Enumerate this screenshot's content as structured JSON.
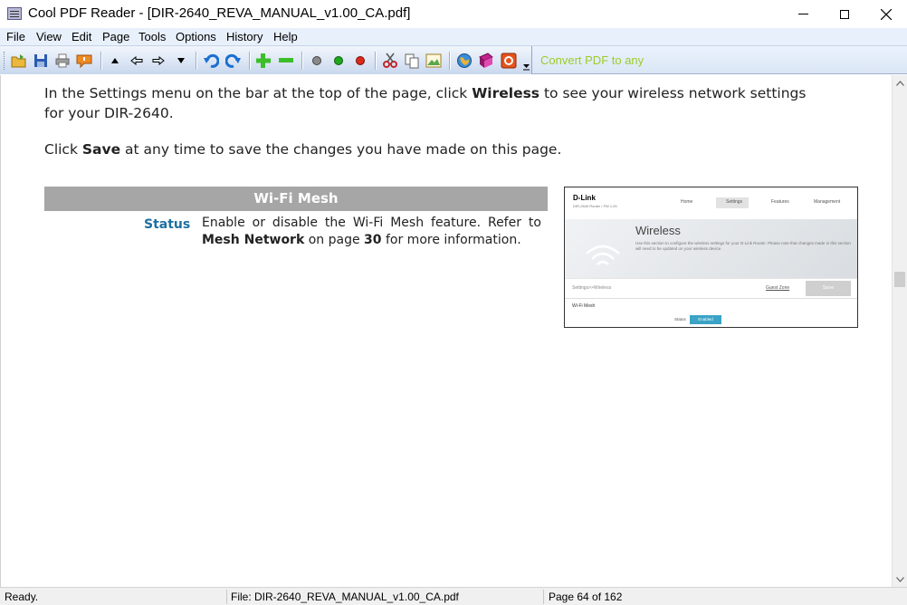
{
  "window": {
    "title": "Cool PDF Reader - [DIR-2640_REVA_MANUAL_v1.00_CA.pdf]"
  },
  "menu": [
    {
      "label": "File"
    },
    {
      "label": "View"
    },
    {
      "label": "Edit"
    },
    {
      "label": "Page"
    },
    {
      "label": "Tools"
    },
    {
      "label": "Options"
    },
    {
      "label": "History"
    },
    {
      "label": "Help"
    }
  ],
  "toolbar": {
    "convert_label": "Convert PDF to any",
    "icons": [
      "open-folder-icon",
      "save-icon",
      "print-icon",
      "comment-icon",
      "page-up-icon",
      "back-icon",
      "forward-icon",
      "page-down-icon",
      "undo-icon",
      "redo-icon",
      "zoom-in-icon",
      "zoom-out-icon",
      "gray-dot-icon",
      "green-dot-icon",
      "red-dot-icon",
      "cut-icon",
      "copy-icon",
      "image-icon",
      "globe-icon",
      "book-icon",
      "pdf-convert-icon"
    ]
  },
  "document": {
    "para1_a": "In the Settings menu on the bar at the top of the page, click ",
    "para1_bold": "Wireless",
    "para1_b": " to see your wireless network settings for your DIR-2640.",
    "para2_a": "Click ",
    "para2_bold": "Save",
    "para2_b": " at any time to save the changes you have made on this page.",
    "section_header": "Wi-Fi Mesh",
    "status_label": "Status",
    "status_desc_a": "Enable or disable the Wi-Fi Mesh feature. Refer to ",
    "status_desc_bold1": "Mesh Network",
    "status_desc_b": " on page ",
    "status_desc_bold2": "30",
    "status_desc_c": " for more information.",
    "screenshot": {
      "logo": "D-Link",
      "subtitle": "DIR-2640 Router / FW 1.00",
      "nav": [
        "Home",
        "Settings",
        "Features",
        "Management"
      ],
      "heading": "Wireless",
      "description": "Use this section to configure the wireless settings for your D-Link Router. Please note that changes made in this section will need to be updated on your wireless device.",
      "breadcrumb": "Settings>>Wireless",
      "guest_zone": "Guest Zone",
      "save": "Save",
      "mesh_label": "Wi-Fi Mesh",
      "status_label": "Status",
      "status_value": "Enabled"
    }
  },
  "statusbar": {
    "state": "Ready.",
    "file": "File: DIR-2640_REVA_MANUAL_v1.00_CA.pdf",
    "page": "Page 64 of 162"
  }
}
